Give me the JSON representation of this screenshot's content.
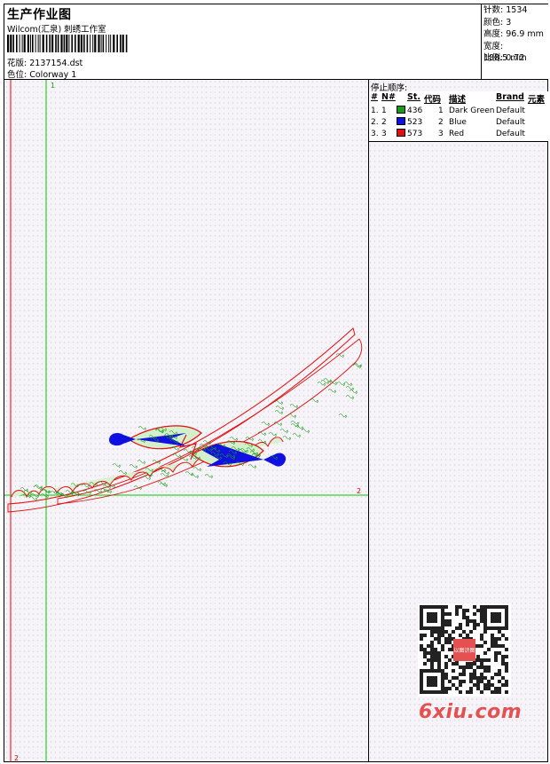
{
  "header": {
    "title": "生产作业图",
    "studio": "Wilcom(汇泉) 刺绣工作室",
    "design_label": "花版:",
    "design_value": "2137154.dst",
    "colorway_label": "色位:",
    "colorway_value": "Colorway 1"
  },
  "stats": [
    {
      "label": "针数:",
      "value": "1534"
    },
    {
      "label": "颜色:",
      "value": "3"
    },
    {
      "label": "高度:",
      "value": "96.9 mm"
    },
    {
      "label": "宽度:",
      "value": "188.5 mm"
    },
    {
      "label": "比例:",
      "value": "0.72"
    }
  ],
  "design": {
    "top_marker": "1",
    "right_marker": "2",
    "bottom_marker": "2"
  },
  "stop_sequence": {
    "title": "停止顺序:",
    "headers": [
      "#",
      "N#",
      "St.",
      "代码",
      "描述",
      "Brand",
      "元素"
    ],
    "rows": [
      {
        "num": "1.",
        "n": "1",
        "st": "436",
        "code": "1",
        "desc": "Dark Green",
        "brand": "Default",
        "color": "#1a9a1a"
      },
      {
        "num": "2.",
        "n": "2",
        "st": "523",
        "code": "2",
        "desc": "Blue",
        "brand": "Default",
        "color": "#1010e0"
      },
      {
        "num": "3.",
        "n": "3",
        "st": "573",
        "code": "3",
        "desc": "Red",
        "brand": "Default",
        "color": "#e01010"
      }
    ]
  },
  "watermark": {
    "text": "6xiu.com",
    "seal_text": "以图识图"
  },
  "colors": {
    "green": "#1a9a1a",
    "blue": "#1010e0",
    "red": "#e01010",
    "guide_green": "#00cc00",
    "guide_red": "#ff0000"
  }
}
